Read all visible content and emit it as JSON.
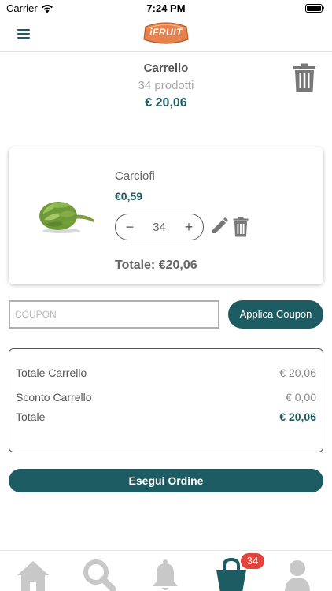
{
  "status_bar": {
    "carrier": "Carrier",
    "time": "7:24 PM"
  },
  "header": {
    "logo_text": "iFRUIT"
  },
  "cart_summary": {
    "title": "Carrello",
    "count": "34 prodotti",
    "total": "€ 20,06"
  },
  "product": {
    "name": "Carciofi",
    "price": "€0,59",
    "quantity": "34",
    "minus_label": "−",
    "plus_label": "+",
    "total": "Totale: €20,06"
  },
  "coupon": {
    "placeholder": "COUPON",
    "value": "",
    "button_label": "Applica Coupon"
  },
  "totals": {
    "rows": [
      {
        "label": "Totale Carrello",
        "value": "€ 20,06"
      },
      {
        "label": "Sconto Carrello",
        "value": "€ 0,00"
      },
      {
        "label": "Totale",
        "value": "€ 20,06"
      }
    ]
  },
  "order_button": {
    "label": "Esegui Ordine"
  },
  "tab_bar": {
    "cart_badge": "34",
    "icons": [
      "home-icon",
      "search-icon",
      "bell-icon",
      "cart-bag-icon",
      "user-icon"
    ]
  },
  "colors": {
    "primary": "#1e5c63",
    "badge": "#e0443a",
    "logo": "#e8824a",
    "icon_gray": "#c8c8c8"
  }
}
